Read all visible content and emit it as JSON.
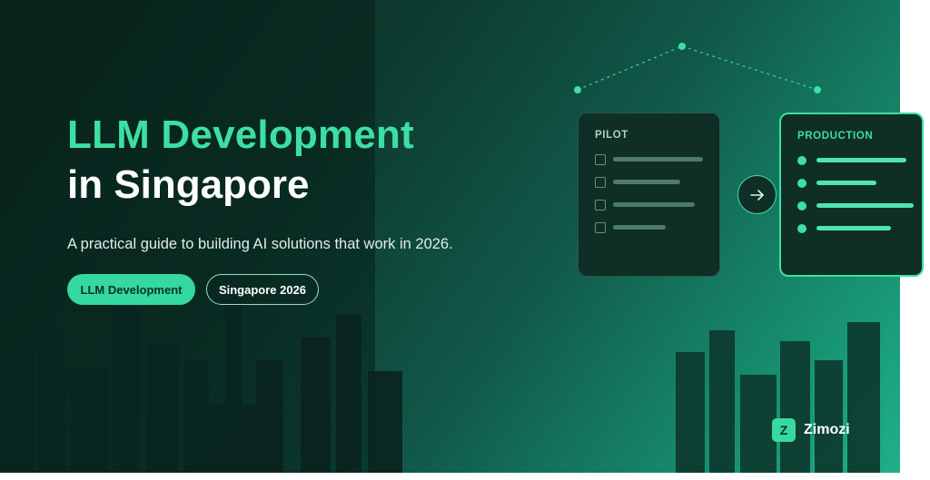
{
  "hero": {
    "title_line1": "LLM Development",
    "title_line2": "in Singapore",
    "subtitle": "A practical guide to building AI solutions that work in 2026."
  },
  "tags": {
    "primary": "LLM Development",
    "secondary": "Singapore 2026"
  },
  "pilot_card": {
    "label": "PILOT",
    "item_count": 4
  },
  "production_card": {
    "label": "PRODUCTION",
    "item_count": 4
  },
  "icons": {
    "transition": "arrow-right-icon",
    "checkbox": "checkbox-icon",
    "bullet": "bullet-dot-icon"
  },
  "brand": {
    "logo_letter": "Z",
    "name": "Zimozi"
  },
  "colors": {
    "accent": "#3ddfa2",
    "background_dark": "#0b2a22",
    "background_light": "#1fb08a",
    "text_light": "#ffffff"
  }
}
